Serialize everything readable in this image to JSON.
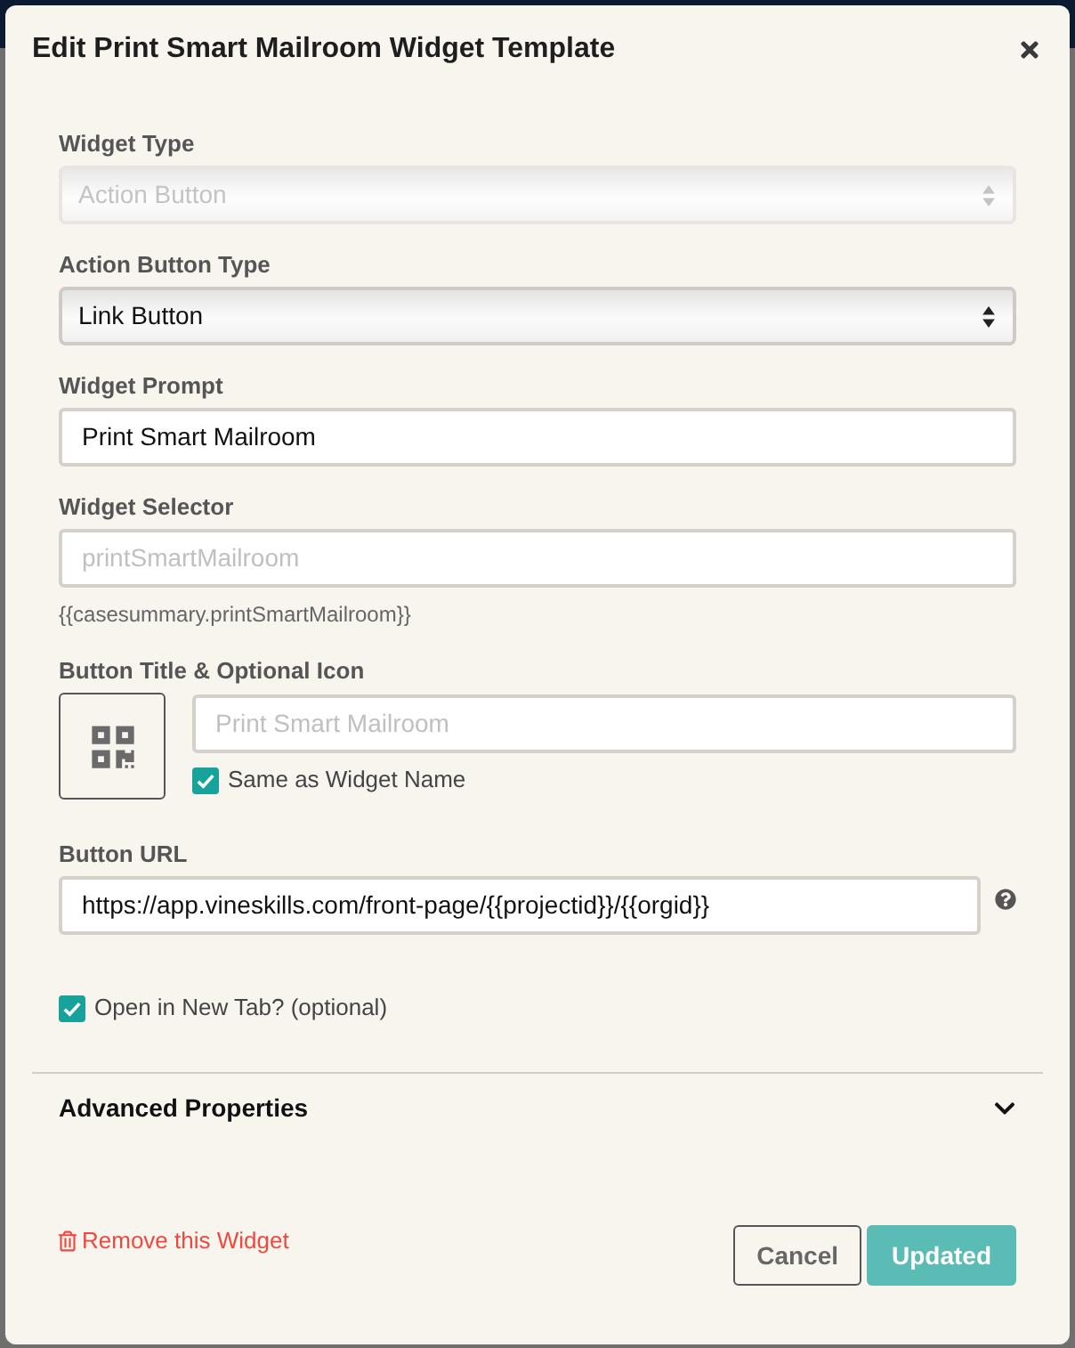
{
  "dialog": {
    "title": "Edit Print Smart Mailroom Widget Template"
  },
  "fields": [
    {
      "kind": "select",
      "label": "Widget Type",
      "value": "Action Button",
      "disabled": true
    },
    {
      "kind": "select",
      "label": "Action Button Type",
      "value": "Link Button",
      "disabled": false
    },
    {
      "kind": "text",
      "label": "Widget Prompt",
      "value": "Print Smart Mailroom"
    },
    {
      "kind": "text",
      "label": "Widget Selector",
      "placeholder": "printSmartMailroom",
      "hint": "{{casesummary.printSmartMailroom}}"
    },
    {
      "kind": "title_icon",
      "label": "Button Title & Optional Icon",
      "placeholder": "Print Smart Mailroom",
      "checkbox": {
        "label": "Same as Widget Name",
        "checked": true
      }
    },
    {
      "kind": "url",
      "label": "Button URL",
      "value": "https://app.vineskills.com/front-page/{{projectid}}/{{orgid}}",
      "help": true
    },
    {
      "kind": "checkbox",
      "label": "Open in New Tab? (optional)",
      "checked": true
    }
  ],
  "advanced": {
    "title": "Advanced Properties",
    "expanded": false
  },
  "remove_link": "Remove this Widget",
  "buttons": [
    {
      "kind": "secondary",
      "label": "Cancel"
    },
    {
      "kind": "primary",
      "label": "Updated"
    }
  ]
}
